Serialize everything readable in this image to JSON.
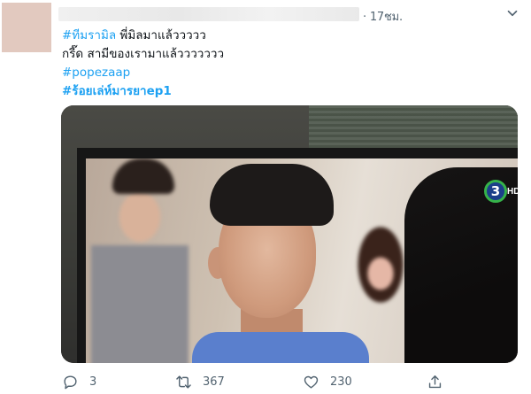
{
  "tweet": {
    "time": "· 17ชม.",
    "lines": [
      {
        "tag": "#ทีมรามิล",
        "rest": " พี่มิลมาแล้ววววว"
      },
      {
        "tag": "",
        "rest": "กรี๊ด สามีของเรามาแล้ววววววว"
      },
      {
        "tag": "#popezaap",
        "rest": ""
      },
      {
        "tag": "#ร้อยเล่ห์มารยาep1",
        "rest": ""
      }
    ],
    "media_logo": {
      "num": "3",
      "hd": "HD"
    }
  },
  "actions": {
    "reply_count": "3",
    "retweet_count": "367",
    "like_count": "230"
  },
  "colors": {
    "accent": "#1da1f2",
    "muted": "#536471"
  }
}
